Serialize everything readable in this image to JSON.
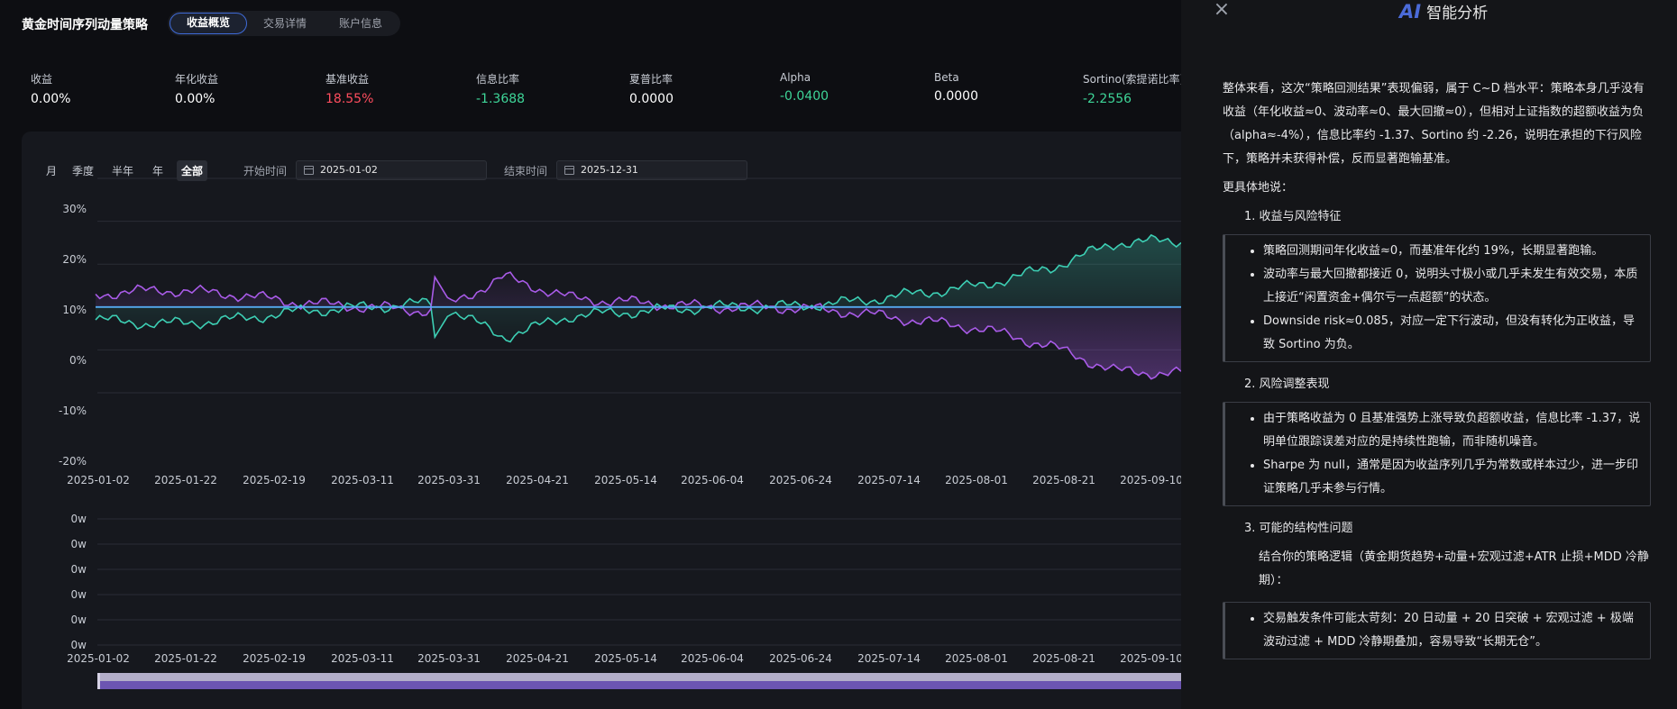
{
  "header": {
    "title": "黄金时间序列动量策略",
    "tabs": [
      {
        "label": "收益概览",
        "active": true
      },
      {
        "label": "交易详情",
        "active": false
      },
      {
        "label": "账户信息",
        "active": false
      }
    ]
  },
  "metrics": [
    {
      "label": "收益",
      "value": "0.00%",
      "tone": "neutral"
    },
    {
      "label": "年化收益",
      "value": "0.00%",
      "tone": "neutral"
    },
    {
      "label": "基准收益",
      "value": "18.55%",
      "tone": "red"
    },
    {
      "label": "信息比率",
      "value": "-1.3688",
      "tone": "green"
    },
    {
      "label": "夏普比率",
      "value": "0.0000",
      "tone": "neutral"
    },
    {
      "label": "Alpha",
      "value": "-0.0400",
      "tone": "green"
    },
    {
      "label": "Beta",
      "value": "0.0000",
      "tone": "neutral"
    },
    {
      "label": "Sortino(索提诺比率)",
      "value": "-2.2556",
      "tone": "green"
    }
  ],
  "controls": {
    "periods": [
      "月",
      "季度",
      "半年",
      "年",
      "全部"
    ],
    "active_period": "全部",
    "start_label": "开始时间",
    "start_value": "2025-01-02",
    "end_label": "结束时间",
    "end_value": "2025-12-31"
  },
  "colors": {
    "strategy": "#55a9f0",
    "benchmark": "#3dcfb4",
    "excess": "#a95be8",
    "accent": "#3f6bd8",
    "positive": "#3ed598",
    "negative": "#ff4d5e"
  },
  "chart_data": [
    {
      "type": "line",
      "x_ticks": [
        "2025-01-02",
        "2025-01-22",
        "2025-02-19",
        "2025-03-11",
        "2025-03-31",
        "2025-04-21",
        "2025-05-14",
        "2025-06-04",
        "2025-06-24",
        "2025-07-14",
        "2025-08-01",
        "2025-08-21",
        "2025-09-10"
      ],
      "y_ticks": [
        "30%",
        "20%",
        "10%",
        "0%",
        "-10%",
        "-20%"
      ],
      "ylim": [
        -20,
        30
      ],
      "series": [
        {
          "key": "strategy",
          "values": [
            0,
            0,
            0,
            0,
            0,
            0,
            0,
            0,
            0,
            0,
            0,
            0,
            0,
            0
          ]
        },
        {
          "key": "benchmark",
          "values": [
            -3,
            -4,
            -3,
            -1,
            0,
            1,
            -7,
            -2,
            -1,
            0,
            0,
            1,
            3,
            5,
            9,
            15,
            15.5
          ]
        },
        {
          "key": "excess",
          "values": [
            3,
            4,
            3,
            1,
            0,
            -1,
            7,
            2,
            1,
            0,
            0,
            -1,
            -3,
            -5,
            -9,
            -15,
            -15.5
          ]
        }
      ]
    },
    {
      "type": "bar",
      "x_ticks": [
        "2025-01-02",
        "2025-01-22",
        "2025-02-19",
        "2025-03-11",
        "2025-03-31",
        "2025-04-21",
        "2025-05-14",
        "2025-06-04",
        "2025-06-24",
        "2025-07-14",
        "2025-08-01",
        "2025-08-21",
        "2025-09-10"
      ],
      "y_ticks": [
        "0w",
        "0w",
        "0w",
        "0w",
        "0w",
        "0w"
      ]
    }
  ],
  "drawer": {
    "close_icon": "×",
    "logo": "AI",
    "title": "智能分析",
    "intro": "整体来看，这次“策略回测结果”表现偏弱，属于 C~D 档水平：策略本身几乎没有收益（年化收益≈0、波动率≈0、最大回撤≈0），但相对上证指数的超额收益为负（alpha≈-4%），信息比率约 -1.37、Sortino 约 -2.26，说明在承担的下行风险下，策略并未获得补偿，反而显著跑输基准。",
    "detail_heading": "更具体地说：",
    "section1": {
      "title": "1. 收益与风险特征",
      "bullets": [
        "策略回测期间年化收益≈0，而基准年化约 19%，长期显著跑输。",
        "波动率与最大回撤都接近 0，说明头寸极小或几乎未发生有效交易，本质上接近“闲置资金+偶尔亏一点超额”的状态。",
        "Downside risk≈0.085，对应一定下行波动，但没有转化为正收益，导致 Sortino 为负。"
      ]
    },
    "section2": {
      "title": "2. 风险调整表现",
      "bullets": [
        "由于策略收益为 0 且基准强势上涨导致负超额收益，信息比率 -1.37，说明单位跟踪误差对应的是持续性跑输，而非随机噪音。",
        "Sharpe 为 null，通常是因为收益序列几乎为常数或样本过少，进一步印证策略几乎未参与行情。"
      ]
    },
    "section3": {
      "title": "3. 可能的结构性问题",
      "text": "结合你的策略逻辑（黄金期货趋势+动量+宏观过滤+ATR 止损+MDD 冷静期）：",
      "bullets": [
        "交易触发条件可能太苛刻：20 日动量 + 20 日突破 + 宏观过滤 + 极端波动过滤 + MDD 冷静期叠加，容易导致“长期无仓”。"
      ]
    }
  }
}
